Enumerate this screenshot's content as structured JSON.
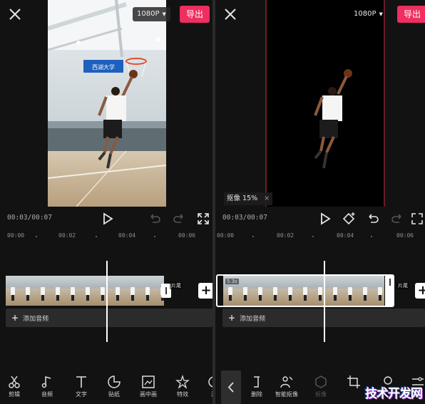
{
  "left_panel": {
    "resolution_label": "1080P",
    "export_label": "导出",
    "timecode": "00:03/00:07",
    "ruler_ticks": [
      "00:00",
      "00:02",
      "00:04",
      "00:06"
    ],
    "clip_tag": "片尾",
    "add_audio_label": "添加音频",
    "hoop_sign": "西湖大学",
    "tools": [
      {
        "icon": "scissors-icon",
        "label": "剪辑"
      },
      {
        "icon": "music-note-icon",
        "label": "音频"
      },
      {
        "icon": "text-icon",
        "label": "文字"
      },
      {
        "icon": "sticker-icon",
        "label": "贴纸"
      },
      {
        "icon": "picture-in-picture-icon",
        "label": "画中画"
      },
      {
        "icon": "effects-icon",
        "label": "特效"
      },
      {
        "icon": "filter-icon",
        "label": "滤"
      }
    ]
  },
  "right_panel": {
    "resolution_label": "1080P",
    "export_label": "导出",
    "timecode": "00:03/00:07",
    "ruler_ticks": [
      "00:00",
      "00:02",
      "00:04",
      "00:06"
    ],
    "matting_status": "抠像 15%",
    "clip_duration": "5.3s",
    "clip_tag": "片尾",
    "add_audio_label": "添加音频",
    "tools": [
      {
        "icon": "delete-icon",
        "label": "删除"
      },
      {
        "icon": "smart-matting-icon",
        "label": "智能抠像"
      },
      {
        "icon": "chroma-key-icon",
        "label": "抠像"
      },
      {
        "icon": "crop-icon",
        "label": ""
      },
      {
        "icon": "shape-icon",
        "label": ""
      },
      {
        "icon": "adjust-icon",
        "label": ""
      }
    ]
  },
  "watermark": "技术开发网",
  "colors": {
    "accent": "#ee2f5f",
    "background": "#121212",
    "playhead": "#ffffff"
  }
}
